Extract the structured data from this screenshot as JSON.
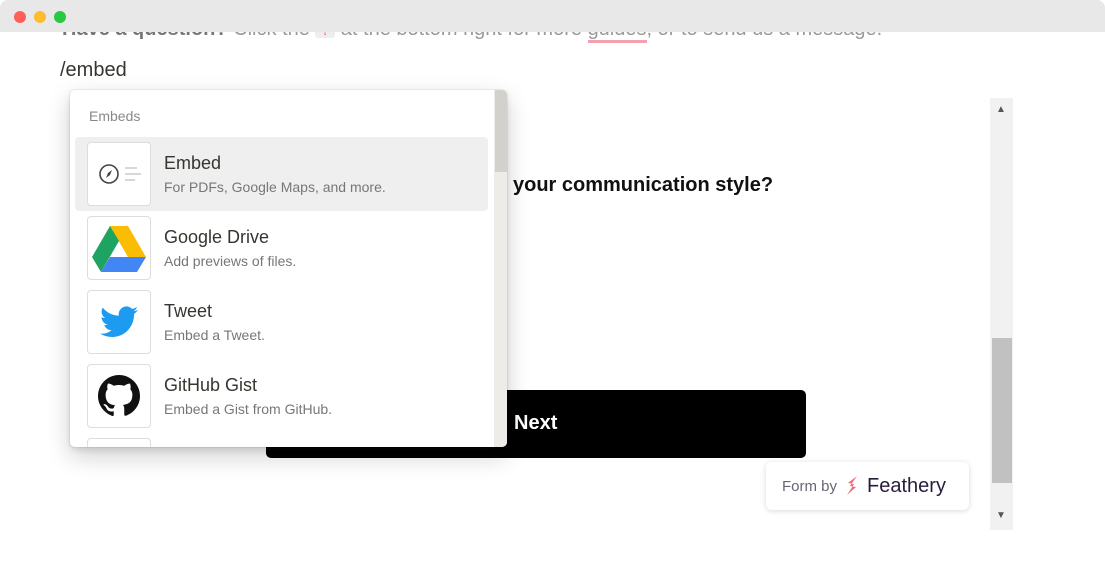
{
  "hint": {
    "bold": "Have a question?",
    "pre": " Click the ",
    "key": "?",
    "mid": " at the bottom right for more ",
    "link": "guides",
    "post": ", or to send us a message."
  },
  "command": "/embed",
  "form": {
    "question": "your communication style?",
    "next_label": "Next",
    "badge_prefix": "Form by",
    "badge_brand": "Feathery"
  },
  "menu": {
    "section": "Embeds",
    "items": [
      {
        "name": "Embed",
        "desc": "For PDFs, Google Maps, and more."
      },
      {
        "name": "Google Drive",
        "desc": "Add previews of files."
      },
      {
        "name": "Tweet",
        "desc": "Embed a Tweet."
      },
      {
        "name": "GitHub Gist",
        "desc": "Embed a Gist from GitHub."
      }
    ]
  }
}
